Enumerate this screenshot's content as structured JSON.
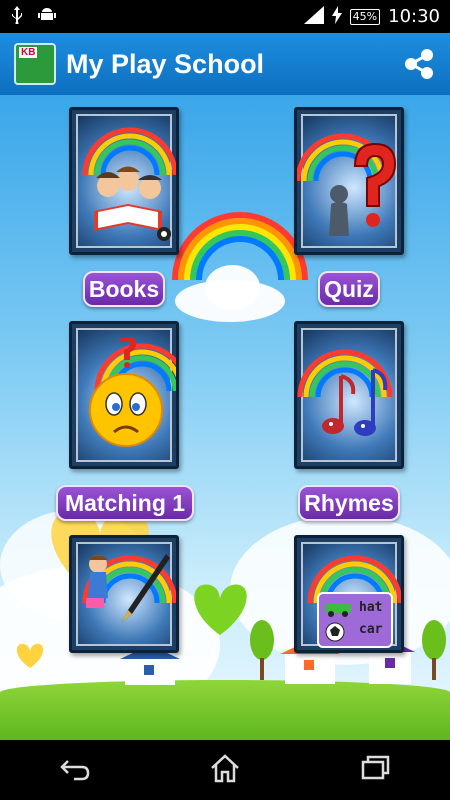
{
  "status_bar": {
    "battery": "45%",
    "time": "10:30"
  },
  "app_bar": {
    "title": "My Play School",
    "logo_text": "KB"
  },
  "tiles": [
    {
      "label": "Books"
    },
    {
      "label": "Quiz"
    },
    {
      "label": "Matching 1"
    },
    {
      "label": "Rhymes"
    },
    {
      "label": ""
    },
    {
      "label": ""
    }
  ],
  "card_texts": {
    "hat": "hat",
    "car": "car"
  },
  "colors": {
    "app_bar": "#1d8ee0",
    "label_button": "#8a44c9"
  }
}
